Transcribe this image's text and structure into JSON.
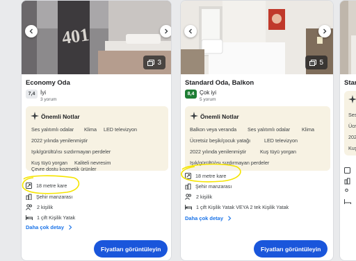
{
  "cards": [
    {
      "photo_count": "3",
      "title": "Economy Oda",
      "score": "7,4",
      "rating_word": "İyi",
      "reviews": "3 yorum",
      "notes_title": "Önemli Notlar",
      "notes": [
        "Ses yalıtımlı odalar",
        "Klima",
        "LED televizyon",
        "2022 yılında yenilenmiştir",
        "Işık/gürültü/ısı sızdırmayan perdeler",
        "Kuş tüyü yorgan",
        "Kaliteli nevresim",
        "Çevre dostu kozmetik ürünler"
      ],
      "features": [
        "18 metre kare",
        "Şehir manzarası",
        "2 kişilik",
        "1 çift Kişilik Yatak"
      ],
      "more_label": "Daha çok detay",
      "cta_label": "Fiyatları görüntüleyin"
    },
    {
      "photo_count": "5",
      "title": "Standard Oda, Balkon",
      "score": "8,4",
      "rating_word": "Çok iyi",
      "reviews": "5 yorum",
      "notes_title": "Önemli Notlar",
      "notes": [
        "Balkon veya veranda",
        "Ses yalıtımlı odalar",
        "Klima",
        "Ücretsiz beşik/çocuk yatağı",
        "LED televizyon",
        "2022 yılında yenilenmiştir",
        "Kuş tüyü yorgan",
        "Işık/gürültü/ısı sızdırmayan perdeler"
      ],
      "features": [
        "18 metre kare",
        "Şehir manzarası",
        "2 kişilik",
        "1 çift Kişilik Yatak VEYA 2 tek Kişilik Yatak"
      ],
      "more_label": "Daha çok detay",
      "cta_label": "Fiyatları görüntüleyin"
    },
    {
      "title": "Stan",
      "notes_partial": [
        "Ses",
        "Ücr",
        "202",
        "Kuş"
      ]
    }
  ],
  "colors": {
    "score_plain": "#e8eaed",
    "score_good": "#1e7e34",
    "accent": "#1a56db",
    "highlight": "#f5e400"
  }
}
